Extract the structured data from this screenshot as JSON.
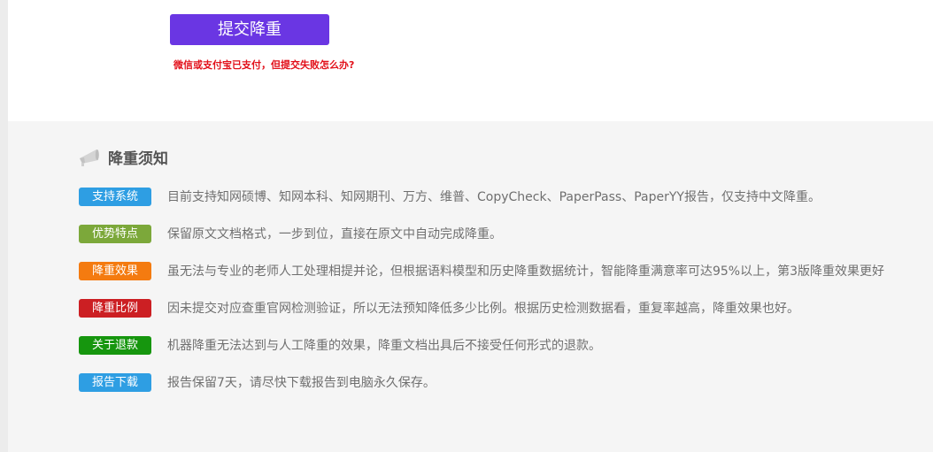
{
  "submit": {
    "button_label": "提交降重",
    "fail_link": "微信或支付宝已支付，但提交失败怎么办?"
  },
  "notice": {
    "title": "降重须知",
    "icon": "megaphone-icon",
    "items": [
      {
        "badge": "支持系统",
        "color": "#2e9ee3",
        "text": "目前支持知网硕博、知网本科、知网期刊、万方、维普、CopyCheck、PaperPass、PaperYY报告，仅支持中文降重。"
      },
      {
        "badge": "优势特点",
        "color": "#7ca83a",
        "text": "保留原文文档格式，一步到位，直接在原文中自动完成降重。"
      },
      {
        "badge": "降重效果",
        "color": "#f47b10",
        "text": "虽无法与专业的老师人工处理相提并论，但根据语料模型和历史降重数据统计，智能降重满意率可达95%以上，第3版降重效果更好"
      },
      {
        "badge": "降重比例",
        "color": "#cc1f23",
        "text": "因未提交对应查重官网检测验证，所以无法预知降低多少比例。根据历史检测数据看，重复率越高，降重效果也好。"
      },
      {
        "badge": "关于退款",
        "color": "#16960e",
        "text": "机器降重无法达到与人工降重的效果，降重文档出具后不接受任何形式的退款。"
      },
      {
        "badge": "报告下载",
        "color": "#2e9ee3",
        "text": "报告保留7天，请尽快下载报告到电脑永久保存。"
      }
    ]
  }
}
